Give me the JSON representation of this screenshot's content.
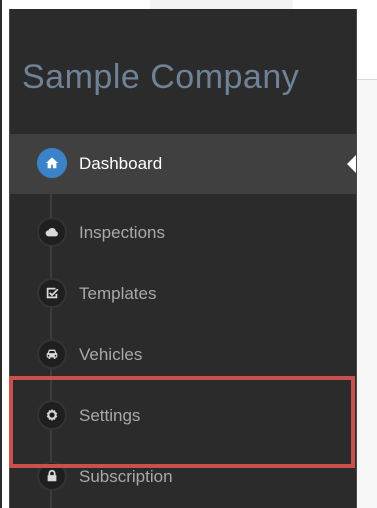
{
  "sidebar": {
    "company_name": "Sample Company",
    "items": [
      {
        "label": "Dashboard",
        "icon": "home-icon",
        "active": true
      },
      {
        "label": "Inspections",
        "icon": "cloud-icon",
        "active": false
      },
      {
        "label": "Templates",
        "icon": "checkbox-icon",
        "active": false
      },
      {
        "label": "Vehicles",
        "icon": "car-icon",
        "active": false
      },
      {
        "label": "Settings",
        "icon": "gear-icon",
        "active": false
      },
      {
        "label": "Subscription",
        "icon": "lock-icon",
        "active": false
      }
    ]
  },
  "colors": {
    "sidebar_bg": "#2b2b2b",
    "active_item_bg": "#404040",
    "accent": "#3a83c9",
    "company_text": "#6f8296",
    "highlight": "#c9504f"
  }
}
